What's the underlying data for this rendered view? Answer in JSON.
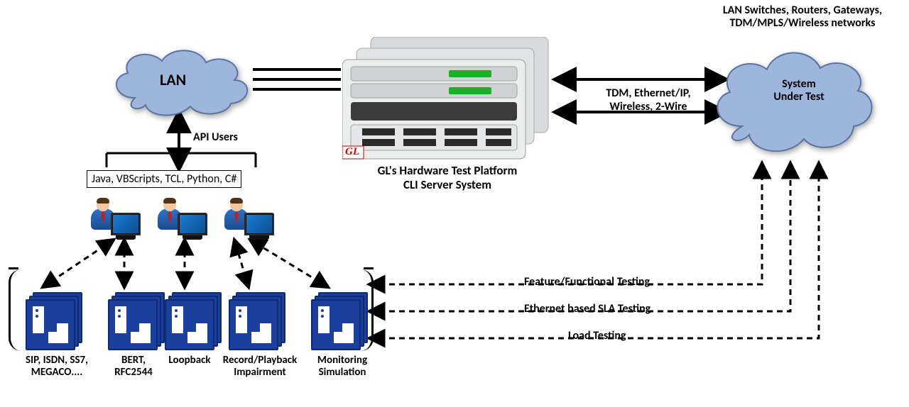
{
  "lan_label": "LAN",
  "api_users_label": "API Users",
  "languages_label": "Java, VBScripts, TCL, Python, C#",
  "server": {
    "caption_line1": "GL's Hardware Test Platform",
    "caption_line2": "CLI Server System",
    "badge": "GL"
  },
  "sut": {
    "top_line1": "LAN Switches, Routers, Gateways,",
    "top_line2": "TDM/MPLS/Wireless networks",
    "cloud_line1": "System",
    "cloud_line2": "Under Test"
  },
  "link": {
    "line1": "TDM, Ethernet/IP,",
    "line2": "Wireless, 2-Wire"
  },
  "tests": {
    "t1": "Feature/Functional Testing",
    "t2": "Ethernet based SLA Testing",
    "t3": "Load Testing"
  },
  "tiles": {
    "sip": {
      "line1": "SIP, ISDN, SS7,",
      "line2": "MEGACO...."
    },
    "bert": {
      "line1": "BERT,",
      "line2": "RFC2544"
    },
    "loop": {
      "line1": "Loopback",
      "line2": ""
    },
    "rec": {
      "line1": "Record/Playback",
      "line2": "Impairment"
    },
    "mon": {
      "line1": "Monitoring",
      "line2": "Simulation"
    }
  }
}
